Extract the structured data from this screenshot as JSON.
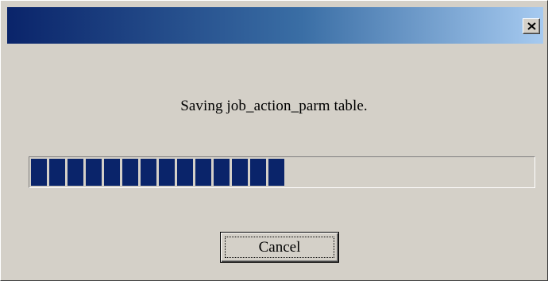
{
  "window": {
    "title": "",
    "close_icon": "close-icon"
  },
  "dialog": {
    "message": "Saving job_action_parm table.",
    "progress": {
      "percent": 53,
      "filled_blocks": 14,
      "fill_color": "#0a246a"
    },
    "cancel_label": "Cancel"
  },
  "colors": {
    "face": "#d4d0c8",
    "title_gradient_start": "#0a246a",
    "title_gradient_end": "#a6caf0"
  }
}
